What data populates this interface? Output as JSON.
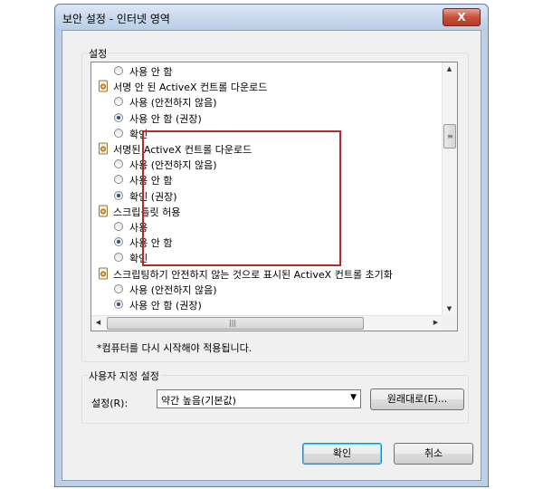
{
  "window": {
    "title": "보안 설정 - 인터넷 영역",
    "close_label": "X"
  },
  "settings_group": {
    "label": "설정"
  },
  "list": {
    "items": [
      {
        "kind": "option",
        "label": "사용 안 함",
        "checked": false
      },
      {
        "kind": "category",
        "label": "서명 안 된 ActiveX 컨트롤 다운로드"
      },
      {
        "kind": "option",
        "label": "사용 (안전하지 않음)",
        "checked": false
      },
      {
        "kind": "option",
        "label": "사용 안 함 (권장)",
        "checked": true
      },
      {
        "kind": "option",
        "label": "확인",
        "checked": false
      },
      {
        "kind": "category",
        "label": "서명된 ActiveX 컨트롤 다운로드"
      },
      {
        "kind": "option",
        "label": "사용 (안전하지 않음)",
        "checked": false
      },
      {
        "kind": "option",
        "label": "사용 안 함",
        "checked": false
      },
      {
        "kind": "option",
        "label": "확인 (권장)",
        "checked": true
      },
      {
        "kind": "category",
        "label": "스크립틀릿 허용"
      },
      {
        "kind": "option",
        "label": "사용",
        "checked": false
      },
      {
        "kind": "option",
        "label": "사용 안 함",
        "checked": true
      },
      {
        "kind": "option",
        "label": "확인",
        "checked": false
      },
      {
        "kind": "category",
        "label": "스크립팅하기 안전하지 않는 것으로 표시된 ActiveX 컨트롤 초기화"
      },
      {
        "kind": "option",
        "label": "사용 (안전하지 않음)",
        "checked": false
      },
      {
        "kind": "option",
        "label": "사용 안 함 (권장)",
        "checked": true
      }
    ]
  },
  "restart_note": "*컴퓨터를 다시 시작해야 적용됩니다.",
  "custom_group": {
    "label": "사용자 지정 설정",
    "reset_label": "설정(R):",
    "level_value": "약간 높음(기본값)",
    "reset_button": "원래대로(E)..."
  },
  "buttons": {
    "ok": "확인",
    "cancel": "취소"
  },
  "colors": {
    "highlight_border": "#b52a2a",
    "title_gradient_top": "#dbe7f5"
  }
}
